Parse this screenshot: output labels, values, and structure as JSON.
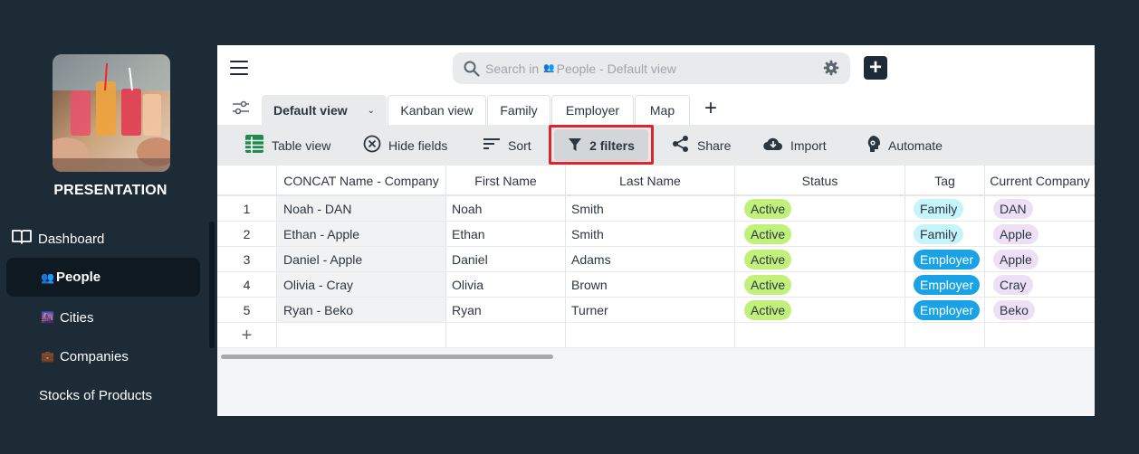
{
  "sidebar": {
    "app_name": "PRESENTATION",
    "items": [
      {
        "label": "Dashboard",
        "icon": "book-icon"
      },
      {
        "label": "People",
        "icon": "people-emoji"
      },
      {
        "label": "Cities",
        "icon": "cityscape-emoji"
      },
      {
        "label": "Companies",
        "icon": "briefcase-emoji"
      },
      {
        "label": "Stocks of Products",
        "icon": ""
      }
    ]
  },
  "topbar": {
    "search_prefix": "Search in",
    "search_table": "People - Default view",
    "add_label": "+"
  },
  "tabs": [
    {
      "label": "Default view",
      "active": true
    },
    {
      "label": "Kanban view"
    },
    {
      "label": "Family"
    },
    {
      "label": "Employer"
    },
    {
      "label": "Map"
    }
  ],
  "toolbar": {
    "table_view": "Table view",
    "hide_fields": "Hide fields",
    "sort": "Sort",
    "filters": "2 filters",
    "share": "Share",
    "import": "Import",
    "automate": "Automate"
  },
  "table": {
    "columns": [
      "CONCAT Name - Company",
      "First Name",
      "Last Name",
      "Status",
      "Tag",
      "Current Company"
    ],
    "rows": [
      {
        "n": "1",
        "concat": "Noah - DAN",
        "first": "Noah",
        "last": "Smith",
        "status": "Active",
        "tag": "Family",
        "company": "DAN"
      },
      {
        "n": "2",
        "concat": "Ethan - Apple",
        "first": "Ethan",
        "last": "Smith",
        "status": "Active",
        "tag": "Family",
        "company": "Apple"
      },
      {
        "n": "3",
        "concat": "Daniel - Apple",
        "first": "Daniel",
        "last": "Adams",
        "status": "Active",
        "tag": "Employer",
        "company": "Apple"
      },
      {
        "n": "4",
        "concat": "Olivia - Cray",
        "first": "Olivia",
        "last": "Brown",
        "status": "Active",
        "tag": "Employer",
        "company": "Cray"
      },
      {
        "n": "5",
        "concat": "Ryan - Beko",
        "first": "Ryan",
        "last": "Turner",
        "status": "Active",
        "tag": "Employer",
        "company": "Beko"
      }
    ],
    "add_row": "+"
  },
  "colors": {
    "background": "#1d2b37",
    "status_active": "#c1f17a",
    "tag_family": "#c5f4fb",
    "tag_employer": "#1aa2e6",
    "company_pill": "#ecdff6",
    "filter_highlight": "#e0242a"
  }
}
